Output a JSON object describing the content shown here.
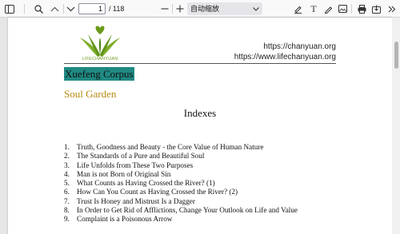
{
  "toolbar": {
    "page_current": "1",
    "page_total": "/ 118",
    "zoom_label": "自动缩放"
  },
  "page": {
    "logo_text": "LIFECHANYUAN",
    "url_1": "https://chanyuan.org",
    "url_2": "https://www.lifechanyuan.org",
    "corpus_title": "Xuefeng Corpus",
    "subtitle": "Soul Garden",
    "heading": "Indexes",
    "toc": [
      {
        "num": "1.",
        "title": "Truth, Goodness and Beauty - the Core Value of Human Nature"
      },
      {
        "num": "2.",
        "title": "The Standards of a Pure and Beautiful Soul"
      },
      {
        "num": "3.",
        "title": "Life Unfolds from These Two Purposes"
      },
      {
        "num": "4.",
        "title": "Man is not Born of Original Sin"
      },
      {
        "num": "5.",
        "title": "What Counts as Having Crossed the River? (1)"
      },
      {
        "num": "6.",
        "title": "How Can You Count as Having Crossed the River? (2)"
      },
      {
        "num": "7.",
        "title": "Trust Is Honey and Mistrust Is a Dagger"
      },
      {
        "num": "8.",
        "title": "In Order to Get Rid of Afflictions, Change Your Outlook on Life and Value"
      },
      {
        "num": "9.",
        "title": "Complaint is a Poisonous Arrow"
      }
    ]
  },
  "colors": {
    "highlight": "#1f8a82",
    "subtitle": "#b88a12",
    "logo_green": "#6b9a1c"
  },
  "icons": [
    "sidebar-toggle-icon",
    "search-icon",
    "chevron-up-icon",
    "chevron-down-icon",
    "zoom-out-icon",
    "zoom-in-icon",
    "chevron-down-icon",
    "highlight-icon",
    "text-icon",
    "draw-icon",
    "image-icon",
    "print-icon",
    "save-icon",
    "more-tools-icon"
  ]
}
